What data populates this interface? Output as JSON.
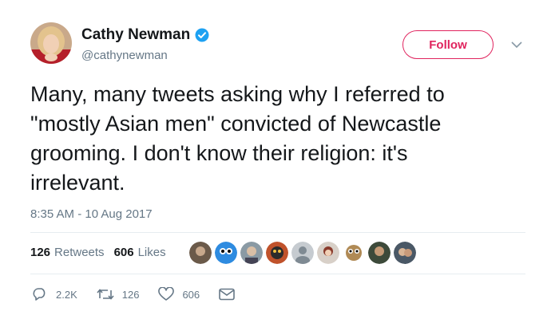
{
  "tweet": {
    "author_name": "Cathy Newman",
    "handle": "@cathynewman",
    "follow_label": "Follow",
    "text_lines": [
      "Many, many tweets asking why I referred to",
      "\"mostly Asian men\" convicted of Newcastle",
      "grooming. I don't know their religion: it's",
      "irrelevant."
    ],
    "timestamp": "8:35 AM - 10 Aug 2017"
  },
  "stats": {
    "retweets_count": "126",
    "retweets_label": "Retweets",
    "likes_count": "606",
    "likes_label": "Likes"
  },
  "actions": {
    "reply_count": "2.2K",
    "retweet_count": "126",
    "like_count": "606"
  },
  "icons": {
    "verified": "verified-badge-icon",
    "caret": "chevron-down-icon",
    "reply": "reply-icon",
    "retweet": "retweet-icon",
    "like": "heart-icon",
    "dm": "envelope-icon"
  },
  "colors": {
    "follow_accent": "#e0245e",
    "verified_blue": "#1da1f2",
    "muted_text": "#657786",
    "primary_text": "#14171a"
  }
}
